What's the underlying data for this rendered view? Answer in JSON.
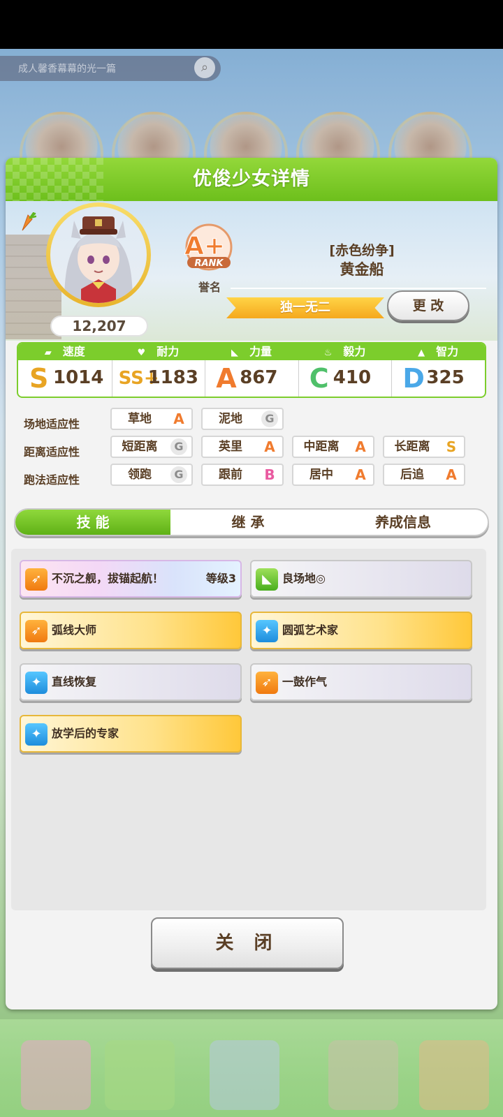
{
  "background": {
    "search_placeholder": "成人馨香幕幕的光一篇",
    "search_icon": "search-icon"
  },
  "dialog": {
    "title": "优俊少女详情"
  },
  "profile": {
    "fans_count": "12,207",
    "rank": "A+",
    "rank_word": "RANK",
    "rank_caption": "誉名",
    "epithet": "[赤色纷争]",
    "name": "黄金船",
    "title_ribbon": "独一无二",
    "change_button": "更 改"
  },
  "stats": [
    {
      "name": "速度",
      "icon": "shoe-icon",
      "grade": "S",
      "value": "1014",
      "color": "#e8a423"
    },
    {
      "name": "耐力",
      "icon": "heart-icon",
      "grade": "SS+",
      "value": "1183",
      "color": "#e8a423"
    },
    {
      "name": "力量",
      "icon": "muscle-icon",
      "grade": "A",
      "value": "867",
      "color": "#f07b2e"
    },
    {
      "name": "毅力",
      "icon": "flame-icon",
      "grade": "C",
      "value": "410",
      "color": "#4fc06a"
    },
    {
      "name": "智力",
      "icon": "graduation-cap-icon",
      "grade": "D",
      "value": "325",
      "color": "#4aa8e8"
    }
  ],
  "aptitude": {
    "track_label": "场地适应性",
    "distance_label": "距离适应性",
    "style_label": "跑法适应性",
    "track": [
      {
        "label": "草地",
        "grade": "A"
      },
      {
        "label": "泥地",
        "grade": "G"
      }
    ],
    "distance": [
      {
        "label": "短距离",
        "grade": "G"
      },
      {
        "label": "英里",
        "grade": "A"
      },
      {
        "label": "中距离",
        "grade": "A"
      },
      {
        "label": "长距离",
        "grade": "S"
      }
    ],
    "style": [
      {
        "label": "领跑",
        "grade": "G"
      },
      {
        "label": "跟前",
        "grade": "B"
      },
      {
        "label": "居中",
        "grade": "A"
      },
      {
        "label": "后追",
        "grade": "A"
      }
    ],
    "grade_colors": {
      "A": "#f07b2e",
      "B": "#e95aa0",
      "S": "#e8a423",
      "G": "#8c8c8c"
    }
  },
  "tabs": [
    "技 能",
    "继 承",
    "养成信息"
  ],
  "skills": [
    {
      "name": "不沉之舰，拔锚起航！",
      "level": "等级3",
      "style": "rainbow",
      "icon": "running-horse-icon",
      "icon_color": "orange"
    },
    {
      "name": "良场地◎",
      "level": "",
      "style": "plain",
      "icon": "muscle-icon",
      "icon_color": "green"
    },
    {
      "name": "弧线大师",
      "level": "",
      "style": "gold",
      "icon": "running-horse-icon",
      "icon_color": "orange"
    },
    {
      "name": "圆弧艺术家",
      "level": "",
      "style": "gold",
      "icon": "sparkle-icon",
      "icon_color": "blue"
    },
    {
      "name": "直线恢复",
      "level": "",
      "style": "plain",
      "icon": "sparkle-icon",
      "icon_color": "blue"
    },
    {
      "name": "一鼓作气",
      "level": "",
      "style": "plain",
      "icon": "running-horse-icon",
      "icon_color": "orange"
    },
    {
      "name": "放学后的专家",
      "level": "",
      "style": "gold",
      "icon": "sparkle-icon",
      "icon_color": "blue"
    }
  ],
  "close_button": "关 闭"
}
